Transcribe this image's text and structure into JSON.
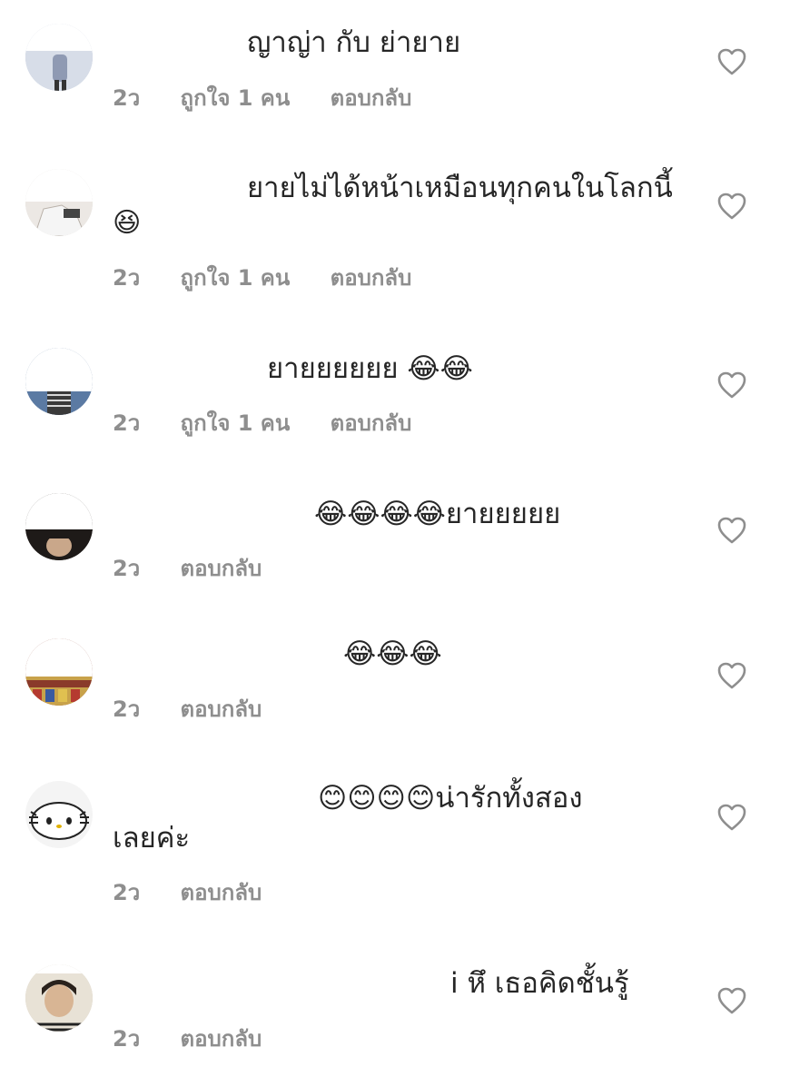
{
  "comments": [
    {
      "text": "ญาญ่า กับ ย่ายาย",
      "time": "2ว",
      "likes": "ถูกใจ 1 คน",
      "reply": "ตอบกลับ",
      "avatar_color": "#b9c2d6"
    },
    {
      "text": "ยายไม่ได้หน้าเหมือนทุกคนในโลกนี้",
      "text_line2": "😆",
      "time": "2ว",
      "likes": "ถูกใจ 1 คน",
      "reply": "ตอบกลับ",
      "avatar_color": "#d9d4cf"
    },
    {
      "text": "ยายยยยยย 😂😂",
      "time": "2ว",
      "likes": "ถูกใจ 1 คน",
      "reply": "ตอบกลับ",
      "avatar_color": "#4a6a94"
    },
    {
      "text": "😂😂😂😂ยายยยยย",
      "time": "2ว",
      "reply": "ตอบกลับ",
      "avatar_color": "#2b2420"
    },
    {
      "text": "😂😂😂",
      "time": "2ว",
      "reply": "ตอบกลับ",
      "avatar_color": "#8a3a2a"
    },
    {
      "text": "😊😊😊😊น่ารักทั้งสอง",
      "text_line2": "เลยค่ะ",
      "time": "2ว",
      "reply": "ตอบกลับ",
      "avatar_color": "#f4f4f4"
    },
    {
      "text": "i หึ เธอคิดชั้นรู้",
      "time": "2ว",
      "reply": "ตอบกลับ",
      "avatar_color": "#cfc7b8"
    }
  ],
  "colors": {
    "text": "#262626",
    "meta": "#8e8e8e",
    "heart_stroke": "#8e8e8e",
    "link_blue": "#2a5aa8"
  },
  "icons": {
    "like": "heart-outline-icon"
  }
}
